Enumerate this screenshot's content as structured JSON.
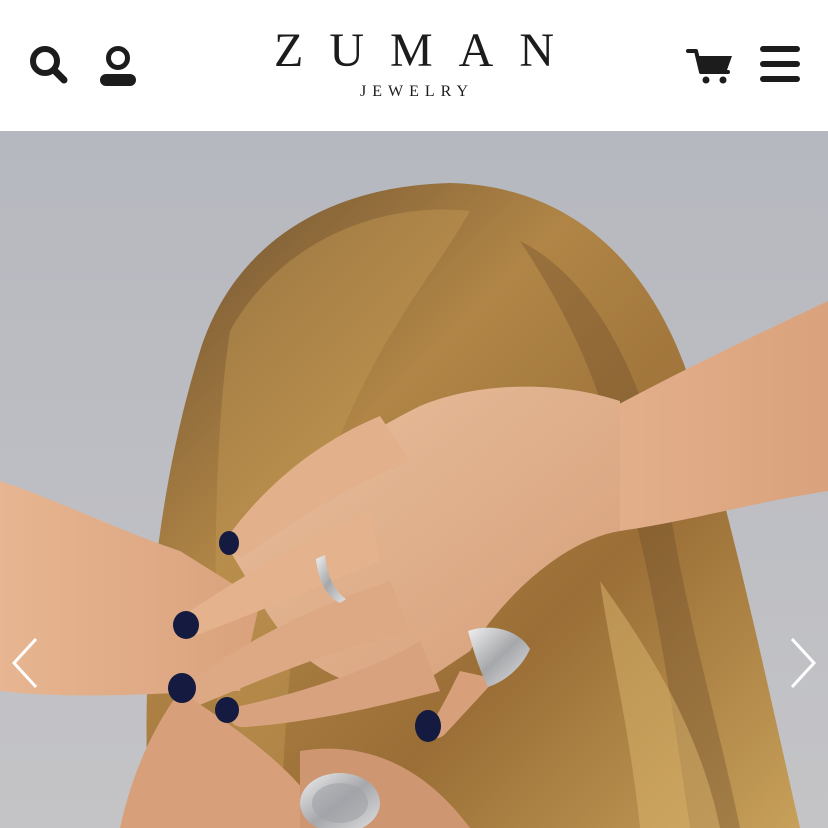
{
  "header": {
    "logo": {
      "name": "ZUMAN",
      "tagline": "JEWELRY"
    },
    "icons": {
      "search": "search-icon",
      "account": "user-icon",
      "cart": "cart-icon",
      "menu": "hamburger-menu-icon"
    }
  },
  "hero": {
    "image": "woman-hands-behind-head-wearing-silver-rings",
    "controls": {
      "prev": "chevron-left-icon",
      "next": "chevron-right-icon"
    }
  },
  "colors": {
    "text": "#1c1c1c",
    "background": "#ffffff",
    "sky": "#b8b9bf",
    "hair": "#a87a3a",
    "skin": "#e0ae88",
    "nail_polish": "#141a40",
    "silver": "#cfd0d2"
  }
}
